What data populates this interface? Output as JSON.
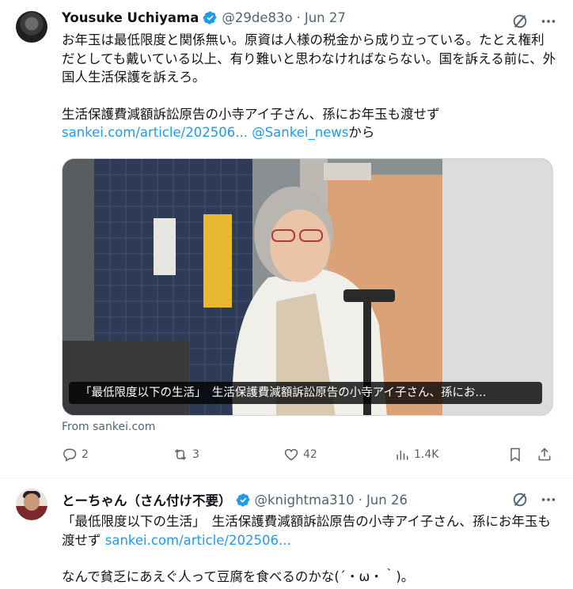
{
  "tweets": [
    {
      "author_name": "Yousuke Uchiyama",
      "handle": "@29de83o",
      "separator": "·",
      "time": "Jun 27",
      "line1": "お年玉は最低限度と関係無い。原資は人様の税金から成り立っている。たとえ権利だとしても戴いている以上、有り難いと思わなければならない。国を訴える前に、外国人生活保護を訴えろ。",
      "line2": "生活保護費減額訴訟原告の小寺アイ子さん、孫にお年玉も渡せず",
      "link_url": "sankei.com/article/202506...",
      "link_mention": "@Sankei_news",
      "link_suffix": "から",
      "media_caption": "「最低限度以下の生活」　生活保護費減額訴訟原告の小寺アイ子さん、孫にお...",
      "source": "From sankei.com",
      "replies": "2",
      "reposts": "3",
      "likes": "42",
      "views": "1.4K"
    },
    {
      "author_name": "とーちゃん（さん付け不要）",
      "handle": "@knightma310",
      "separator": "·",
      "time": "Jun 26",
      "line1_prefix": "「最低限度以下の生活」　生活保護費減額訴訟原告の小寺アイ子さん、孫にお年玉も渡せず ",
      "link_url": "sankei.com/article/202506...",
      "line2": "なんで貧乏にあえぐ人って豆腐を食べるのかな(´・ω・｀)。"
    }
  ],
  "colors": {
    "text": "#0f1419",
    "secondary": "#536471",
    "link": "#1d9bf0",
    "verified": "#1d9bf0",
    "divider": "#eff3f4"
  },
  "icons": [
    "verified-badge-icon",
    "grok-icon",
    "more-icon",
    "reply-icon",
    "repost-icon",
    "like-icon",
    "views-icon",
    "bookmark-icon",
    "share-icon"
  ]
}
